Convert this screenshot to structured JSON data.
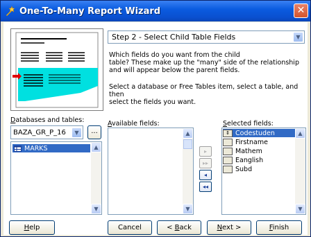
{
  "window": {
    "title": "One-To-Many Report Wizard"
  },
  "step": {
    "selected": "Step 2 - Select Child Table Fields"
  },
  "description": {
    "line1": "Which fields do you want from the child",
    "line2": "table? These make up the \"many\" side of the relationship",
    "line3": "and will appear below the parent fields.",
    "line4": "Select a database or Free Tables item, select a table, and then",
    "line5": "select the fields you want."
  },
  "databases": {
    "label_key": "D",
    "label_rest": "atabases and tables:",
    "selected": "BAZA_GR_P_16",
    "browse_label": "...",
    "tables": [
      "MARKS"
    ]
  },
  "available": {
    "label_key": "A",
    "label_rest": "vailable fields:",
    "items": []
  },
  "selected_fields": {
    "label_key": "S",
    "label_rest": "elected fields:",
    "items": [
      "Codestuden",
      "Firstname",
      "Mathem",
      "Eanglish",
      "Subd"
    ]
  },
  "move_buttons": {
    "add": "▸",
    "add_all": "▸▸",
    "remove": "◂",
    "remove_all": "◂◂"
  },
  "buttons": {
    "help_key": "H",
    "help_rest": "elp",
    "cancel": "Cancel",
    "back_prefix": "< ",
    "back_key": "B",
    "back_rest": "ack",
    "next_key": "N",
    "next_rest": "ext >",
    "finish_key": "F",
    "finish_rest": "inish"
  },
  "colors": {
    "title_bar": "#0a50d0",
    "selection": "#316ac5",
    "chart_fill": "#00e0e0",
    "marker": "#e00000"
  }
}
